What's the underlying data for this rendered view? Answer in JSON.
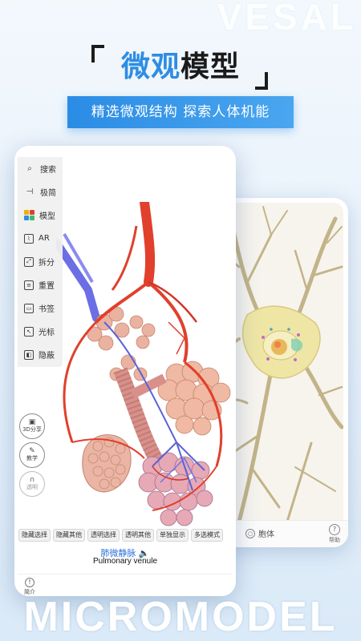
{
  "watermark_top": "VESAL",
  "headline": {
    "highlight": "微观",
    "rest": "模型"
  },
  "banner": "精选微观结构 探索人体机能",
  "toolbar": [
    {
      "label": "搜索",
      "icon": "search-icon"
    },
    {
      "label": "极简",
      "icon": "minimal-icon"
    },
    {
      "label": "模型",
      "icon": "model-grid-icon"
    },
    {
      "label": "AR",
      "icon": "ar-icon"
    },
    {
      "label": "拆分",
      "icon": "split-icon"
    },
    {
      "label": "重置",
      "icon": "reset-icon"
    },
    {
      "label": "书签",
      "icon": "bookmark-icon"
    },
    {
      "label": "光标",
      "icon": "cursor-icon"
    },
    {
      "label": "隐蔽",
      "icon": "hide-icon"
    }
  ],
  "side_buttons": {
    "split3d": "3D分享",
    "teach": "教学",
    "ghost": "透明"
  },
  "bottom_tabs": [
    "隐藏选择",
    "隐藏其他",
    "透明选择",
    "透明其他",
    "单独显示",
    "多选模式"
  ],
  "structure_label": {
    "zh": "肺微静脉",
    "en": "Pulmonary venule"
  },
  "intro_label": "简介",
  "back_phone": {
    "item": "胞体",
    "help": "帮助"
  },
  "watermark_bottom": "MICROMODEL",
  "colors": {
    "accent": "#2d8de3",
    "artery": "#e0402c",
    "vein": "#6c6ee6",
    "alveoli": "#eeb7a6",
    "neuron": "#c9b98c"
  }
}
